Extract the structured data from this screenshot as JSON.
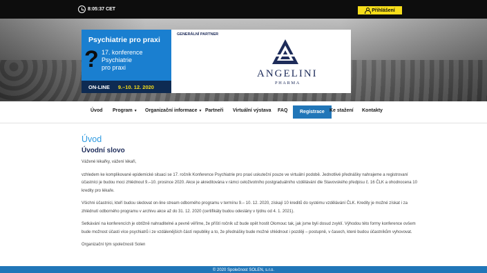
{
  "topbar": {
    "clock_icon": "clock-icon",
    "time": "8:05:37 CET",
    "login_icon": "user-icon",
    "login_label": "Přihlášení",
    "login_color": "#f6dd1a"
  },
  "banner": {
    "conference": {
      "title": "Psychiatrie pro praxi",
      "logo": "?",
      "subtitle_line1": "17. konference",
      "subtitle_line2": "Psychiatrie",
      "subtitle_line3": "pro praxi",
      "mode": "ON-LINE",
      "dates": "9.–10. 12. 2020"
    },
    "partner": {
      "label": "GENERÁLNÍ PARTNER",
      "brand": "ANGELINI",
      "brand_sub": "PHARMA"
    }
  },
  "nav": {
    "items": [
      {
        "label": "Úvod"
      },
      {
        "label": "Program"
      },
      {
        "label": "Organizační informace"
      },
      {
        "label": "Partneři"
      },
      {
        "label": "Virtuální výstava"
      },
      {
        "label": "FAQ"
      },
      {
        "label": "Registrace"
      },
      {
        "label": "Ke stažení"
      },
      {
        "label": "Kontakty"
      }
    ],
    "caret": "▼",
    "active_color": "#2176b8"
  },
  "main": {
    "heading": "Úvod",
    "subheading": "Úvodní slovo",
    "paragraphs": [
      "Vážené lékařky, vážení lékaři,",
      "vzhledem ke komplikované epidemické situaci se 17. ročník Konference Psychiatrie pro praxi uskuteční pouze ve virtuální podobě. Jednotlivé přednášky nahrajeme a registrovaní účastníci je budou moci zhlédnout 9.–10. prosince 2020. Akce je akreditována v rámci celoživotního postgraduálního vzdělávání dle Stavovského předpisu č. 16 ČLK a ohodnocena 10 kredity pro lékaře.",
      "Všichni účastníci, kteří budou sledovat on-line stream odborného programu v termínu 9.– 10. 12. 2020, získají 10 kreditů do systému vzdělávání ČLK. Kredity je možné získat i za zhlédnutí odborného programu v archivu akce až do 31. 12. 2020 (certifikáty budou odeslány v týdnu od 4. 1. 2021).",
      "Setkávání na konferencích je obtížně nahraditelné a pevně věříme, že příští ročník už bude opět hostit Olomouc tak, jak jsme byli dosud zvyklí. Výhodou této formy konference ovšem bude možnost účasti více psychiatrů i ze vzdálenějších částí republiky a to, že přednášky bude možné shlédnout i později – postupně, v časech, které budou účastníkům vyhovovat.",
      "Organizační tým společnosti Solen"
    ]
  },
  "footer": {
    "text": "© 2020 Společnost SOLEN, s.r.o."
  }
}
